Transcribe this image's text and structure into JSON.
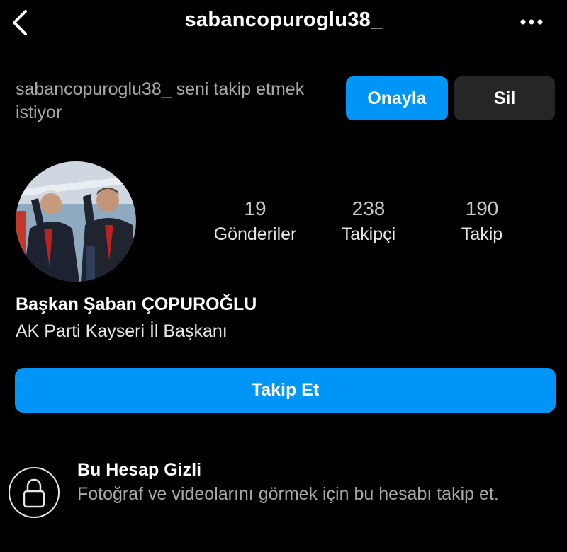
{
  "header": {
    "username": "sabancopuroglu38_",
    "back_icon": "chevron-left-icon",
    "more_icon": "more-horizontal-icon"
  },
  "follow_request": {
    "text": "sabancopuroglu38_ seni takip etmek istiyor",
    "approve_label": "Onayla",
    "delete_label": "Sil"
  },
  "profile": {
    "stats": {
      "posts": {
        "value": "19",
        "label": "Gönderiler"
      },
      "followers": {
        "value": "238",
        "label": "Takipçi"
      },
      "following": {
        "value": "190",
        "label": "Takip"
      }
    },
    "full_name": "Başkan Şaban ÇOPUROĞLU",
    "bio": "AK Parti Kayseri İl Başkanı",
    "follow_label": "Takip Et"
  },
  "private": {
    "icon": "lock-icon",
    "title": "Bu Hesap Gizli",
    "description": "Fotoğraf ve videolarını görmek için bu hesabı takip et."
  },
  "colors": {
    "background": "#000000",
    "accent": "#0095f6",
    "secondary_button": "#262626",
    "muted_text": "#a8a8a8"
  }
}
